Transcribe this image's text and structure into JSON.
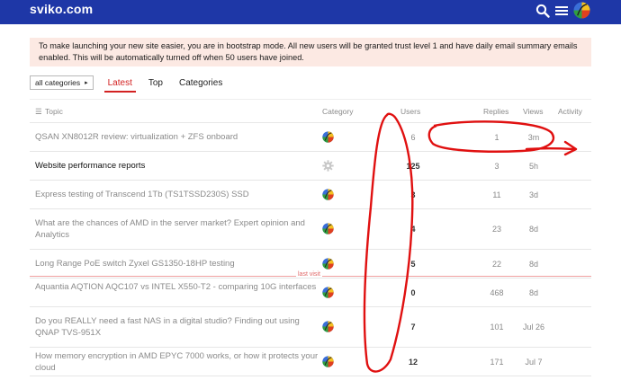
{
  "header": {
    "logo": "sviko.com",
    "icons": [
      "search-icon",
      "menu-icon",
      "avatar"
    ],
    "bg": "#1e37a7"
  },
  "banner": {
    "text": "To make launching your new site easier, you are in bootstrap mode. All new users will be granted trust level 1 and have daily email summary emails enabled. This will be automatically turned off when 50 users have joined."
  },
  "nav": {
    "category_select": "all categories",
    "tabs": [
      {
        "label": "Latest",
        "active": true
      },
      {
        "label": "Top",
        "active": false
      },
      {
        "label": "Categories",
        "active": false
      }
    ]
  },
  "columns": {
    "topic": "Topic",
    "category": "Category",
    "users": "Users",
    "replies": "Replies",
    "views": "Views",
    "activity": "Activity"
  },
  "last_visit": "last visit",
  "topics": [
    {
      "title": "QSAN XN8012R review: virtualization + ZFS onboard",
      "users": "6",
      "replies": "1",
      "activity": "3m",
      "unread": false,
      "icon": "rainbow-category-icon"
    },
    {
      "title": "Website performance reports",
      "users": "125",
      "replies": "3",
      "activity": "5h",
      "unread": true,
      "icon": "gear-icon"
    },
    {
      "title": "Express testing of Transcend 1Tb (TS1TSSD230S) SSD",
      "users": "3",
      "replies": "11",
      "activity": "3d",
      "unread": false,
      "icon": "rainbow-category-icon"
    },
    {
      "title": "What are the chances of AMD in the server market? Expert opinion and Analytics",
      "users": "4",
      "replies": "23",
      "activity": "8d",
      "unread": false,
      "icon": "rainbow-category-icon"
    },
    {
      "title": "Long Range PoE switch Zyxel GS1350-18HP testing",
      "users": "5",
      "replies": "22",
      "activity": "8d",
      "unread": false,
      "icon": "rainbow-category-icon"
    },
    {
      "title": "Aquantia AQTION AQC107 vs INTEL X550-T2 - comparing 10G interfaces",
      "users": "0",
      "replies": "468",
      "activity": "8d",
      "unread": false,
      "icon": "rainbow-category-icon"
    },
    {
      "title": "Do you REALLY need a fast NAS in a digital studio? Finding out using QNAP TVS-951X",
      "users": "7",
      "replies": "101",
      "activity": "Jul 26",
      "unread": false,
      "icon": "rainbow-category-icon"
    },
    {
      "title": "How memory encryption in AMD EPYC 7000 works, or how it protects your cloud",
      "users": "12",
      "replies": "171",
      "activity": "Jul 7",
      "unread": false,
      "icon": "rainbow-category-icon"
    }
  ],
  "annotation_color": "#e01010"
}
